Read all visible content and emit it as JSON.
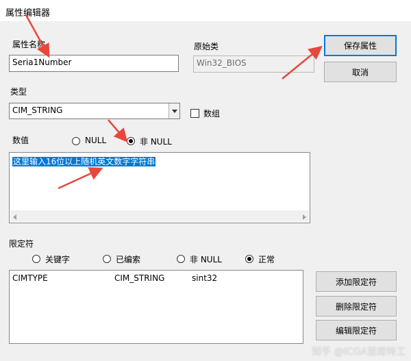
{
  "window": {
    "title": "属性编辑器"
  },
  "property_name": {
    "label": "属性名称",
    "value": "Seria1Number"
  },
  "origin_class": {
    "label": "原始类",
    "value": "Win32_BIOS"
  },
  "buttons": {
    "save": "保存属性",
    "cancel": "取消"
  },
  "type": {
    "label": "类型",
    "selected": "CIM_STRING"
  },
  "array_checkbox": {
    "label": "数组",
    "checked": false
  },
  "value_section": {
    "label": "数值",
    "radio_null": "NULL",
    "radio_not_null": "非 NULL",
    "selected": "非 NULL",
    "text": "这里输入16位以上随机英文数字字符串"
  },
  "qualifiers": {
    "label": "限定符",
    "radios": [
      "关键字",
      "已编索",
      "非 NULL",
      "正常"
    ],
    "selected": "正常",
    "rows": [
      {
        "name": "CIMTYPE",
        "type": "CIM_STRING",
        "value": "sint32"
      }
    ],
    "buttons": {
      "add": "添加限定符",
      "delete": "删除限定符",
      "edit": "编辑限定符"
    }
  },
  "watermark": "知乎 @ICGA首席特工",
  "colors": {
    "accent": "#0078d7",
    "annotation_arrow": "#e8473b",
    "background": "#f0f0f0"
  }
}
